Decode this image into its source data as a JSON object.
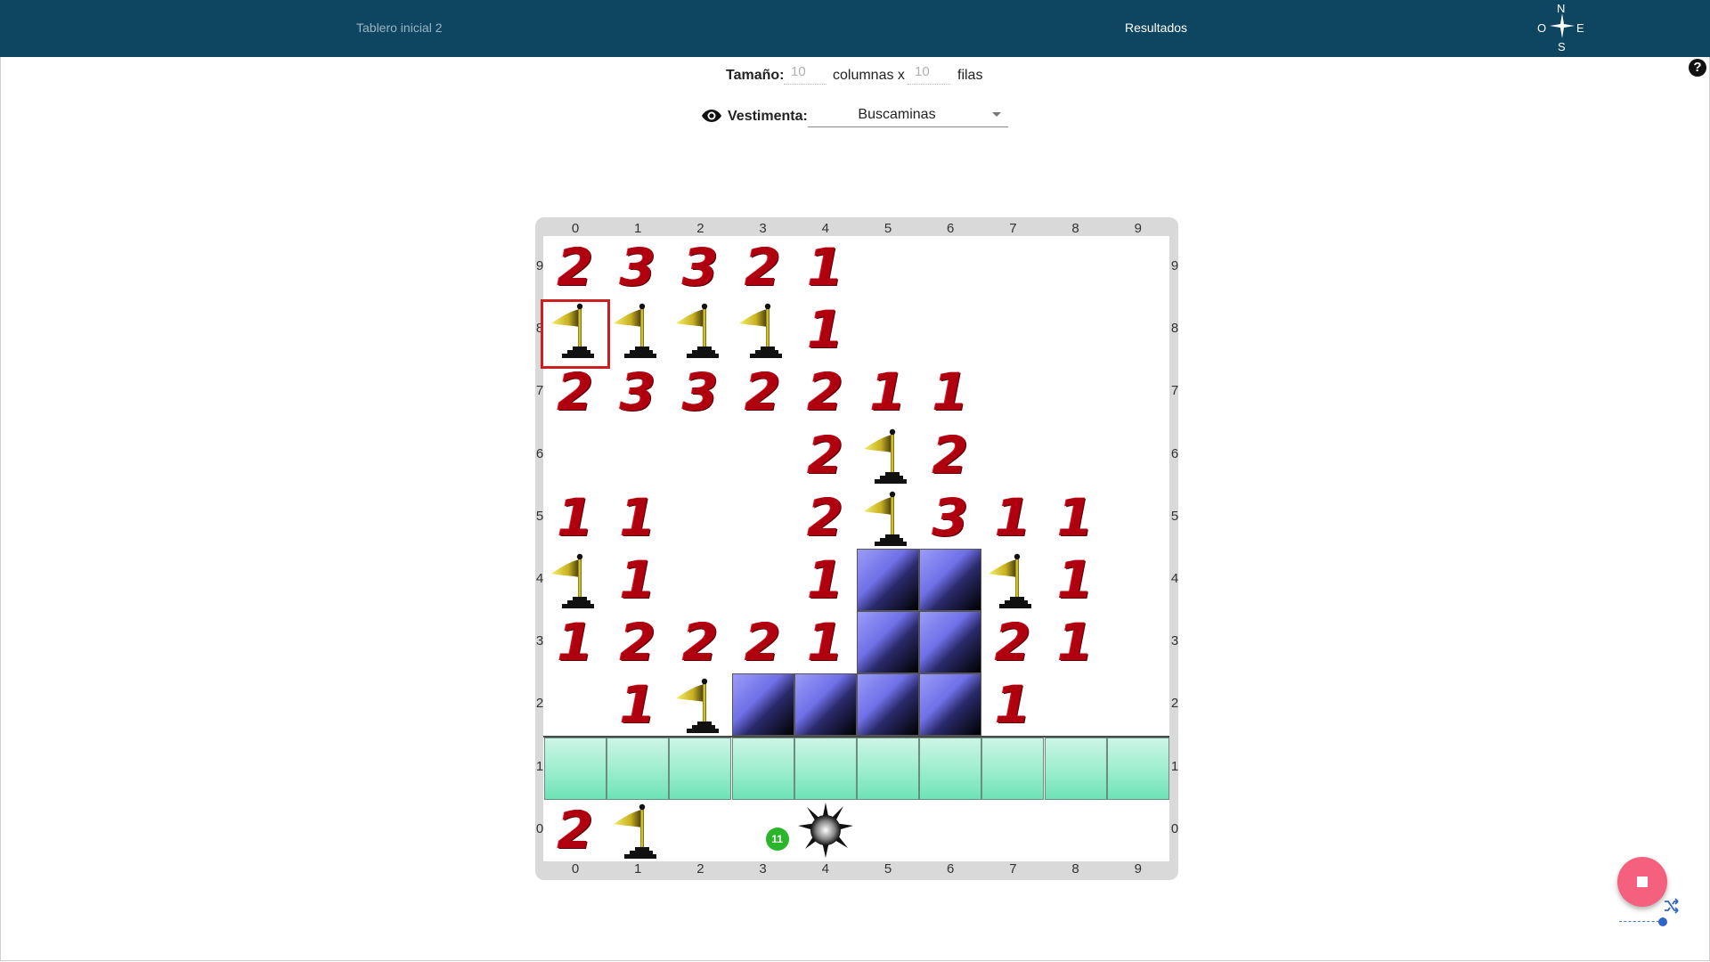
{
  "header": {
    "tab_initial": "Tablero inicial 2",
    "tab_results": "Resultados",
    "compass": {
      "n": "N",
      "s": "S",
      "o": "O",
      "e": "E"
    }
  },
  "size": {
    "label": "Tamaño:",
    "columns_value": "10",
    "columns_text": "columnas x",
    "rows_value": "10",
    "rows_text": "filas"
  },
  "outfit": {
    "label": "Vestimenta:",
    "value": "Buscaminas"
  },
  "board": {
    "columns": 10,
    "rows": 10,
    "col_labels": [
      "0",
      "1",
      "2",
      "3",
      "4",
      "5",
      "6",
      "7",
      "8",
      "9"
    ],
    "row_labels": [
      "0",
      "1",
      "2",
      "3",
      "4",
      "5",
      "6",
      "7",
      "8",
      "9"
    ],
    "numbers": [
      {
        "col": 0,
        "row": 9,
        "v": "2"
      },
      {
        "col": 1,
        "row": 9,
        "v": "3"
      },
      {
        "col": 2,
        "row": 9,
        "v": "3"
      },
      {
        "col": 3,
        "row": 9,
        "v": "2"
      },
      {
        "col": 4,
        "row": 9,
        "v": "1"
      },
      {
        "col": 4,
        "row": 8,
        "v": "1"
      },
      {
        "col": 0,
        "row": 7,
        "v": "2"
      },
      {
        "col": 1,
        "row": 7,
        "v": "3"
      },
      {
        "col": 2,
        "row": 7,
        "v": "3"
      },
      {
        "col": 3,
        "row": 7,
        "v": "2"
      },
      {
        "col": 4,
        "row": 7,
        "v": "2"
      },
      {
        "col": 5,
        "row": 7,
        "v": "1"
      },
      {
        "col": 6,
        "row": 7,
        "v": "1"
      },
      {
        "col": 4,
        "row": 6,
        "v": "2"
      },
      {
        "col": 6,
        "row": 6,
        "v": "2"
      },
      {
        "col": 0,
        "row": 5,
        "v": "1"
      },
      {
        "col": 1,
        "row": 5,
        "v": "1"
      },
      {
        "col": 4,
        "row": 5,
        "v": "2"
      },
      {
        "col": 6,
        "row": 5,
        "v": "3"
      },
      {
        "col": 7,
        "row": 5,
        "v": "1"
      },
      {
        "col": 8,
        "row": 5,
        "v": "1"
      },
      {
        "col": 1,
        "row": 4,
        "v": "1"
      },
      {
        "col": 4,
        "row": 4,
        "v": "1"
      },
      {
        "col": 8,
        "row": 4,
        "v": "1"
      },
      {
        "col": 0,
        "row": 3,
        "v": "1"
      },
      {
        "col": 1,
        "row": 3,
        "v": "2"
      },
      {
        "col": 2,
        "row": 3,
        "v": "2"
      },
      {
        "col": 3,
        "row": 3,
        "v": "2"
      },
      {
        "col": 4,
        "row": 3,
        "v": "1"
      },
      {
        "col": 7,
        "row": 3,
        "v": "2"
      },
      {
        "col": 8,
        "row": 3,
        "v": "1"
      },
      {
        "col": 1,
        "row": 2,
        "v": "1"
      },
      {
        "col": 7,
        "row": 2,
        "v": "1"
      },
      {
        "col": 0,
        "row": 0,
        "v": "2"
      }
    ],
    "flags": [
      {
        "col": 0,
        "row": 8
      },
      {
        "col": 1,
        "row": 8
      },
      {
        "col": 2,
        "row": 8
      },
      {
        "col": 3,
        "row": 8
      },
      {
        "col": 5,
        "row": 6
      },
      {
        "col": 5,
        "row": 5
      },
      {
        "col": 0,
        "row": 4
      },
      {
        "col": 7,
        "row": 4
      },
      {
        "col": 2,
        "row": 2
      },
      {
        "col": 1,
        "row": 0
      }
    ],
    "walls": [
      {
        "col": 5,
        "row": 4
      },
      {
        "col": 6,
        "row": 4
      },
      {
        "col": 5,
        "row": 3
      },
      {
        "col": 6,
        "row": 3
      },
      {
        "col": 3,
        "row": 2
      },
      {
        "col": 4,
        "row": 2
      },
      {
        "col": 5,
        "row": 2
      },
      {
        "col": 6,
        "row": 2
      }
    ],
    "floor_row": 1,
    "selected": {
      "col": 0,
      "row": 8
    },
    "mine": {
      "col": 4,
      "row": 0
    },
    "badge": {
      "col": 3,
      "row": 0,
      "value": "11"
    }
  },
  "icons": {
    "help": "help-icon",
    "eye": "eye-icon",
    "stop": "stop-icon",
    "shuffle": "shuffle-icon",
    "compass": "compass-icon"
  },
  "colors": {
    "header_bg": "#0e4560",
    "number_red": "#b00010",
    "stop_button": "#f4607e",
    "selection": "#cc1f1f"
  }
}
